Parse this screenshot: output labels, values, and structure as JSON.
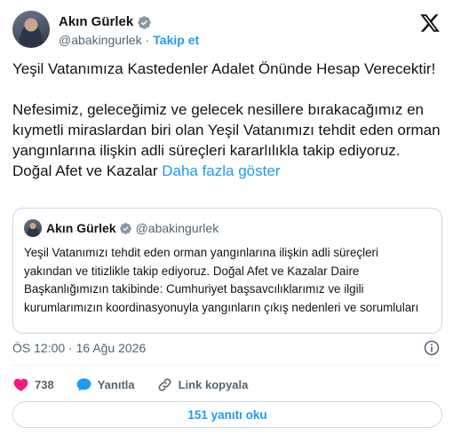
{
  "author": {
    "name": "Akın Gürlek",
    "handle": "@abakingurlek",
    "separator": "·",
    "follow_label": "Takip et"
  },
  "tweet": {
    "paragraph1": "Yeşil Vatanımıza Kastedenler Adalet Önünde Hesap Verecektir!",
    "paragraph2": "Nefesimiz, geleceğimiz ve gelecek nesillere bırakacağımız en kıymetli miraslardan biri olan Yeşil Vatanımızı tehdit eden orman yangınlarına ilişkin adli süreçleri kararlılıkla takip ediyoruz. Doğal Afet ve Kazalar",
    "show_more": "Daha fazla göster"
  },
  "quote": {
    "name": "Akın Gürlek",
    "handle": "@abakingurlek",
    "text": "Yeşil Vatanımızı tehdit eden orman yangınlarına ilişkin adli süreçleri yakından ve titizlikle takip ediyoruz. Doğal Afet ve Kazalar Daire Başkanlığımızın takibinde: Cumhuriyet başsavcılıklarımız ve ilgili kurumlarımızın koordinasyonuyla yangınların çıkış nedenleri ve sorumluları"
  },
  "timestamp": "ÖS 12:00 · 16 Ağu 2026",
  "actions": {
    "likes": "738",
    "reply_label": "Yanıtla",
    "copy_link_label": "Link kopyala"
  },
  "replies_button": "151 yanıtı oku",
  "colors": {
    "accent": "#1d9bf0",
    "like": "#f91880",
    "text": "#0f1419",
    "muted": "#536471",
    "border": "#cfd9de"
  },
  "icons": [
    "verified-badge-icon",
    "x-logo-icon",
    "info-icon",
    "heart-icon",
    "reply-bubble-icon",
    "link-icon"
  ]
}
